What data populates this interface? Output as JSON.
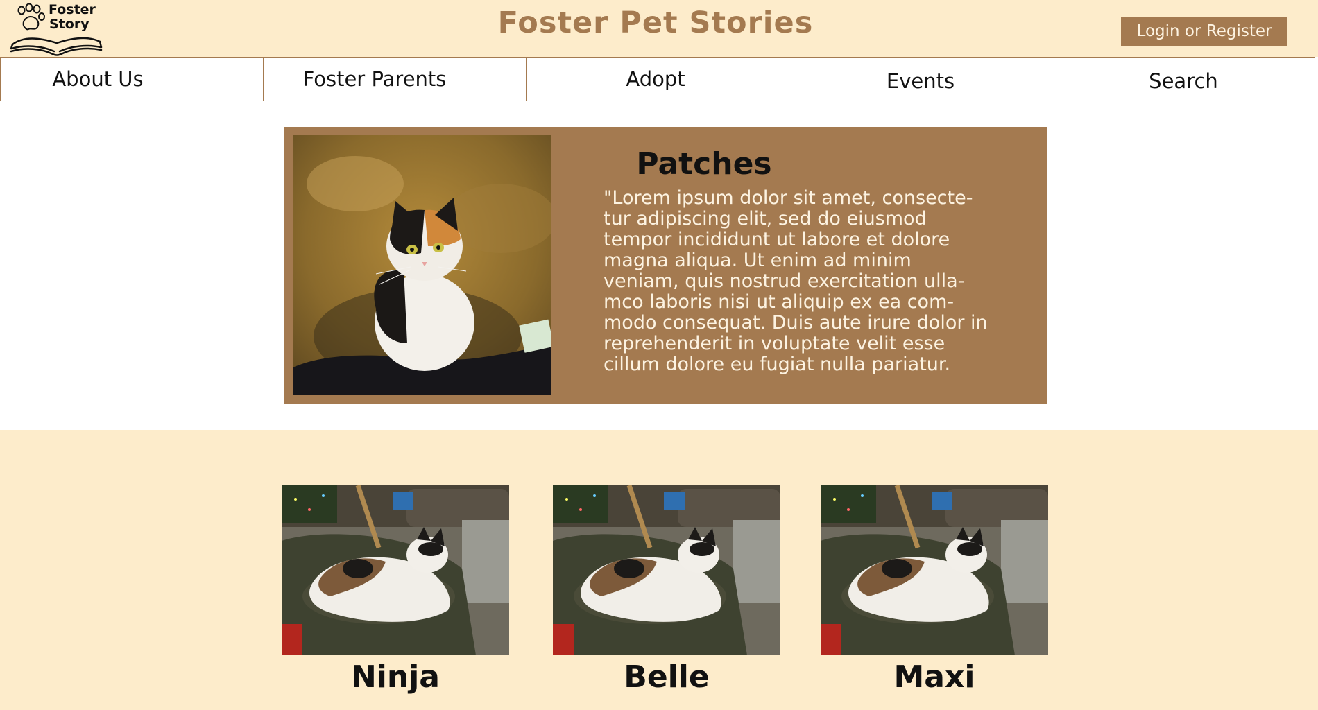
{
  "header": {
    "logo_line1": "Foster",
    "logo_line2": "Story",
    "title": "Foster Pet Stories",
    "login_label": "Login or Register"
  },
  "nav": {
    "items": [
      {
        "label": "About Us"
      },
      {
        "label": "Foster Parents"
      },
      {
        "label": "Adopt"
      },
      {
        "label": "Events"
      },
      {
        "label": "Search"
      }
    ]
  },
  "featured": {
    "name": "Patches",
    "story": "\"Lorem ipsum dolor sit amet, consecte-tur adipiscing elit, sed do eiusmod tempor incididunt ut labore et dolore magna aliqua. Ut enim ad minim veniam, quis nostrud exercitation ulla-mco laboris nisi ut aliquip ex ea com-modo consequat. Duis aute irure dolor in reprehenderit in voluptate velit esse cillum dolore eu fugiat nulla pariatur."
  },
  "pets": [
    {
      "name": "Ninja"
    },
    {
      "name": "Belle"
    },
    {
      "name": "Maxi"
    }
  ],
  "colors": {
    "accent": "#a47a50",
    "cream": "#fdeccb",
    "text_light": "#fdf3e1"
  }
}
